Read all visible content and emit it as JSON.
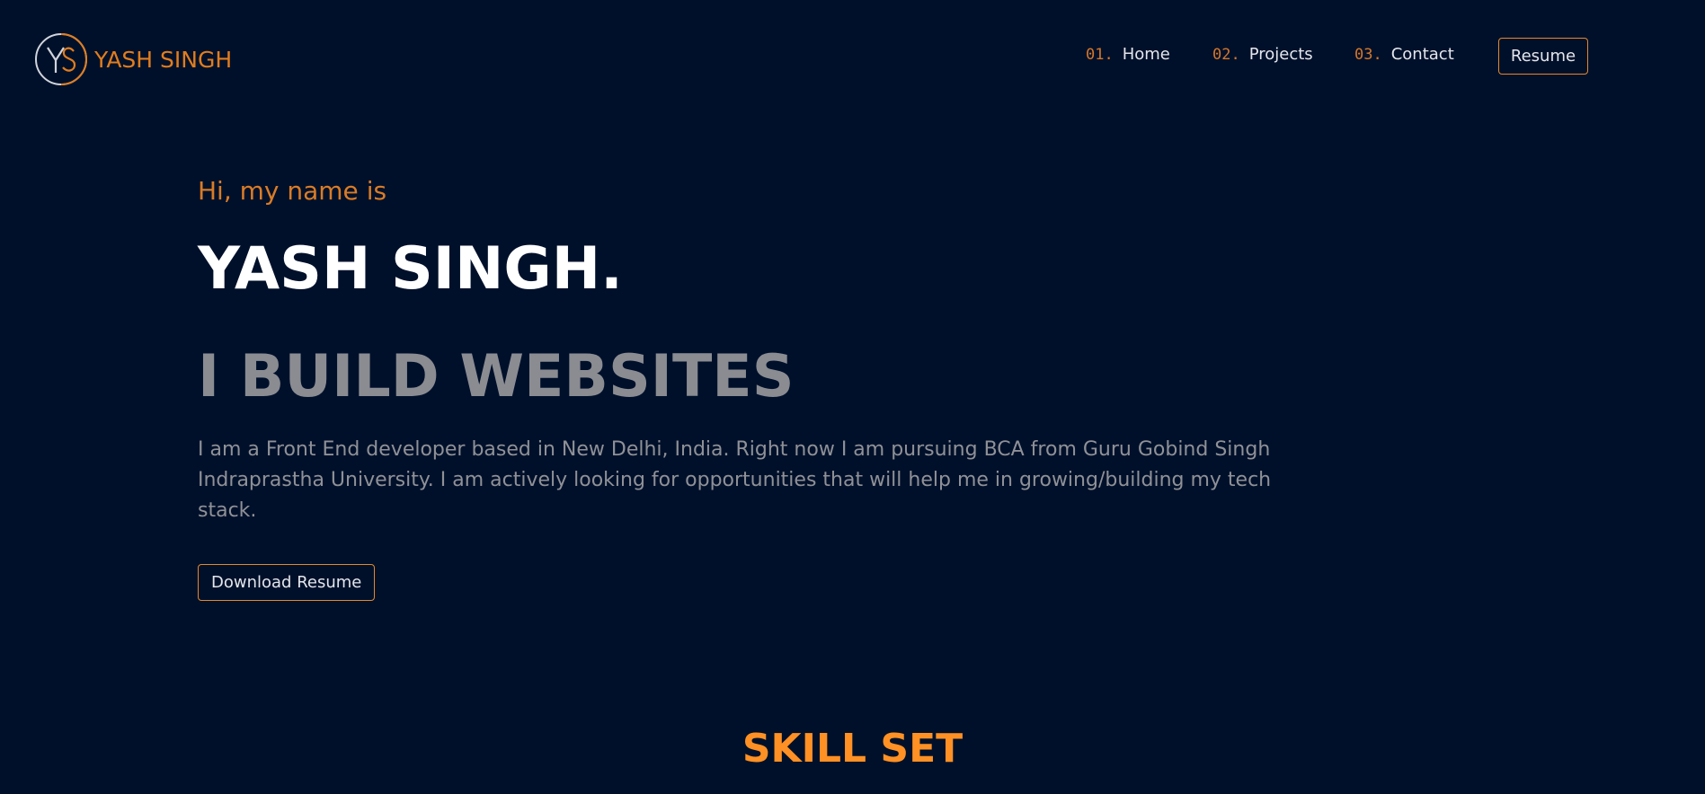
{
  "header": {
    "logo_text": "YASH SINGH",
    "logo_monogram": "YS",
    "resume_label": "Resume"
  },
  "nav": {
    "items": [
      {
        "num": "01.",
        "label": "Home"
      },
      {
        "num": "02.",
        "label": "Projects"
      },
      {
        "num": "03.",
        "label": "Contact"
      }
    ]
  },
  "hero": {
    "greeting": "Hi, my name is",
    "name": "YASH SINGH.",
    "tagline": "I BUILD WEBSITES",
    "bio": "I am a Front End developer based in New Delhi, India. Right now I am pursuing BCA from Guru Gobind Singh Indraprastha University. I am actively looking for opportunities that will help me in growing/building my tech stack.",
    "download_label": "Download Resume"
  },
  "skills": {
    "title": "SKILL SET"
  },
  "colors": {
    "background": "#00102a",
    "accent": "#e07d1e",
    "skills_title": "#ff9124",
    "text_primary": "#ffffff",
    "text_muted": "#8a8c92"
  }
}
